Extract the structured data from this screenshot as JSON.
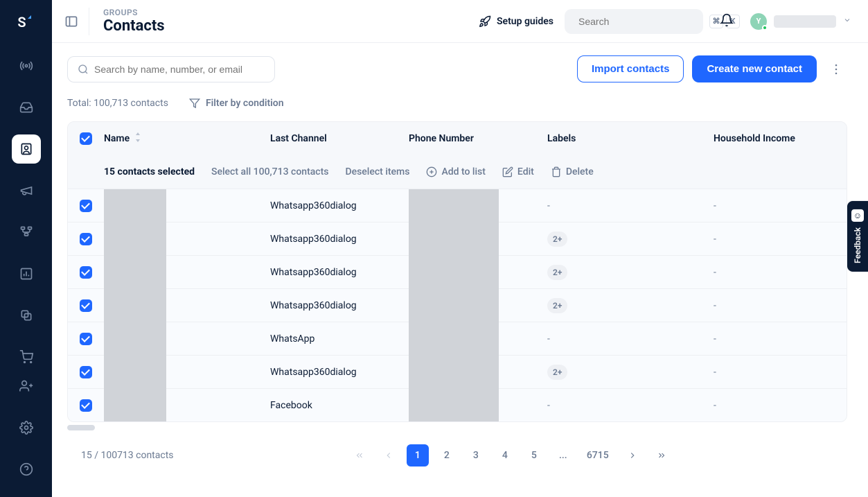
{
  "logo": "S",
  "header": {
    "breadcrumb": "GROUPS",
    "title": "Contacts",
    "setup_guides": "Setup guides",
    "search_placeholder": "Search",
    "kbd1": "⌘",
    "kbd2": "K",
    "avatar_initial": "Y"
  },
  "toolbar": {
    "search_placeholder": "Search by name, number, or email",
    "import_label": "Import contacts",
    "create_label": "Create new contact"
  },
  "summary": {
    "total_text": "Total: 100,713 contacts",
    "filter_label": "Filter by condition"
  },
  "table": {
    "columns": {
      "name": "Name",
      "last_channel": "Last Channel",
      "phone": "Phone Number",
      "labels": "Labels",
      "income": "Household Income"
    },
    "selection": {
      "count_text": "15 contacts selected",
      "select_all": "Select all 100,713 contacts",
      "deselect": "Deselect items",
      "add_to_list": "Add to list",
      "edit": "Edit",
      "delete": "Delete"
    },
    "rows": [
      {
        "channel": "Whatsapp360dialog",
        "labels": "-",
        "income": "-"
      },
      {
        "channel": "Whatsapp360dialog",
        "labels": "2+",
        "income": "-"
      },
      {
        "channel": "Whatsapp360dialog",
        "labels": "2+",
        "income": "-"
      },
      {
        "channel": "Whatsapp360dialog",
        "labels": "2+",
        "income": "-"
      },
      {
        "channel": "WhatsApp",
        "labels": "-",
        "income": "-"
      },
      {
        "channel": "Whatsapp360dialog",
        "labels": "2+",
        "income": "-"
      },
      {
        "channel": "Facebook",
        "labels": "-",
        "income": "-"
      }
    ]
  },
  "pagination": {
    "info": "15 / 100713 contacts",
    "pages": [
      "1",
      "2",
      "3",
      "4",
      "5"
    ],
    "ellipsis": "...",
    "last": "6715"
  },
  "feedback": "Feedback"
}
